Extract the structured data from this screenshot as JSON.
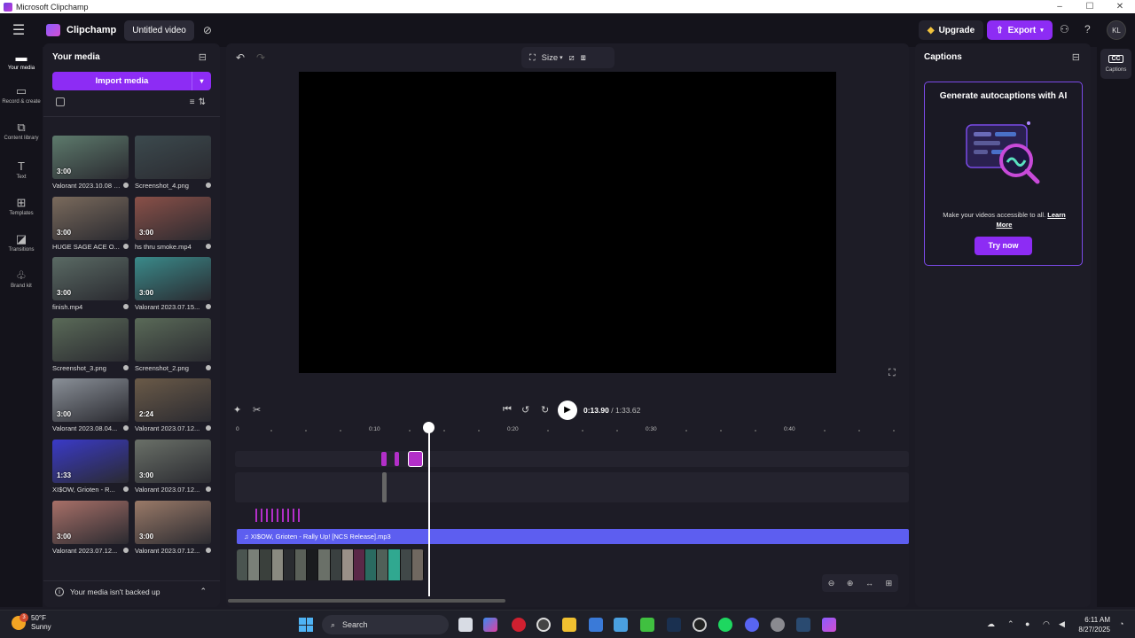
{
  "window": {
    "title": "Microsoft Clipchamp",
    "controls": [
      "–",
      "☐",
      "✕"
    ]
  },
  "header": {
    "brand": "Clipchamp",
    "project_title": "Untitled video",
    "upgrade_label": "Upgrade",
    "export_label": "Export",
    "avatar_initials": "KL"
  },
  "sidebar": {
    "items": [
      {
        "label": "Your media",
        "icon": "folder-icon"
      },
      {
        "label": "Record & create",
        "icon": "camera-icon"
      },
      {
        "label": "Content library",
        "icon": "library-icon"
      },
      {
        "label": "Text",
        "icon": "text-icon"
      },
      {
        "label": "Templates",
        "icon": "templates-icon"
      },
      {
        "label": "Transitions",
        "icon": "transitions-icon"
      },
      {
        "label": "Brand kit",
        "icon": "brand-kit-icon"
      }
    ]
  },
  "media": {
    "title": "Your media",
    "import_label": "Import media",
    "backup_notice": "Your media isn't backed up",
    "items": [
      {
        "name": "Valorant 2023.10.08 - 1...",
        "duration": "3:00",
        "color": "#5d7a6c"
      },
      {
        "name": "Screenshot_4.png",
        "duration": "",
        "color": "#3c4a4e"
      },
      {
        "name": "HUGE SAGE ACE O...",
        "duration": "3:00",
        "color": "#7a6a5c"
      },
      {
        "name": "hs thru smoke.mp4",
        "duration": "3:00",
        "color": "#8a5048"
      },
      {
        "name": "finish.mp4",
        "duration": "3:00",
        "color": "#5a6a64"
      },
      {
        "name": "Valorant 2023.07.15...",
        "duration": "3:00",
        "color": "#3a8a8a"
      },
      {
        "name": "Screenshot_3.png",
        "duration": "",
        "color": "#5a6a58"
      },
      {
        "name": "Screenshot_2.png",
        "duration": "",
        "color": "#5a6a58"
      },
      {
        "name": "Valorant 2023.08.04...",
        "duration": "3:00",
        "color": "#8a9098"
      },
      {
        "name": "Valorant 2023.07.12...",
        "duration": "2:24",
        "color": "#6a5a48"
      },
      {
        "name": "XI$OW, Grioten - R...",
        "duration": "1:33",
        "color": "#3a3ac8"
      },
      {
        "name": "Valorant 2023.07.12...",
        "duration": "3:00",
        "color": "#6a7068"
      },
      {
        "name": "Valorant 2023.07.12...",
        "duration": "3:00",
        "color": "#a87068"
      },
      {
        "name": "Valorant 2023.07.12...",
        "duration": "3:00",
        "color": "#9a7a68"
      }
    ]
  },
  "editor": {
    "size_label": "Size",
    "current_time": "0:13.90",
    "total_time": "/ 1:33.62",
    "ruler_labels": [
      "0",
      "0:10",
      "0:20",
      "0:30",
      "0:40"
    ],
    "audio_clip_name": "XI$OW, Grioten - Rally Up! [NCS Release].mp3",
    "accent": "#8d2cf4",
    "audio_color": "#5d5ef0"
  },
  "captions": {
    "title": "Captions",
    "card_title": "Generate autocaptions with AI",
    "card_desc": "Make your videos accessible to all.",
    "learn_more": "Learn More",
    "try_label": "Try now",
    "rail_label": "Captions",
    "rail_icon": "CC"
  },
  "taskbar": {
    "temperature": "50°F",
    "condition": "Sunny",
    "weather_badge": "3",
    "search_placeholder": "Search",
    "time": "6:11 AM",
    "date": "8/27/2025"
  }
}
